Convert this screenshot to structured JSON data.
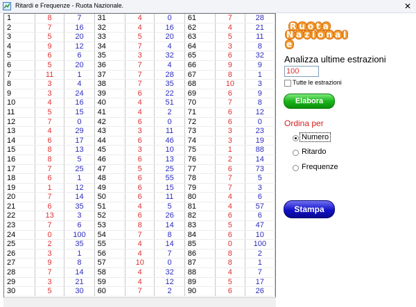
{
  "window": {
    "title": "Ritardi e Frequenze - Ruota Nazionale.",
    "close_symbol": "✕"
  },
  "logo": {
    "line1": "Ruota",
    "line2": "Nazionale",
    "color": "#f29a2e"
  },
  "controls": {
    "analizza_label": "Analizza ultime estrazioni",
    "estrazioni_value": "100",
    "tutte_label": "Tutte le estrazioni",
    "elabora_label": "Elabora",
    "ordina_label": "Ordina per",
    "sort_options": [
      "Numero",
      "Ritardo",
      "Frequenze"
    ],
    "sort_selected": "Numero",
    "stampa_label": "Stampa"
  },
  "colors": {
    "ritardo": "#e03030",
    "frequenza": "#2c2cc0",
    "elabora": "#1bb51b",
    "stampa": "#1212c8"
  },
  "table_rows": [
    [
      1,
      8,
      7,
      31,
      4,
      0,
      61,
      7,
      28
    ],
    [
      2,
      7,
      16,
      32,
      4,
      16,
      62,
      4,
      21
    ],
    [
      3,
      5,
      20,
      33,
      5,
      20,
      63,
      5,
      11
    ],
    [
      4,
      9,
      12,
      34,
      7,
      4,
      64,
      3,
      8
    ],
    [
      5,
      6,
      6,
      35,
      3,
      32,
      65,
      6,
      32
    ],
    [
      6,
      5,
      20,
      36,
      7,
      4,
      66,
      9,
      9
    ],
    [
      7,
      11,
      1,
      37,
      7,
      28,
      67,
      8,
      1
    ],
    [
      8,
      3,
      4,
      38,
      7,
      35,
      68,
      10,
      3
    ],
    [
      9,
      3,
      24,
      39,
      6,
      22,
      69,
      6,
      9
    ],
    [
      10,
      4,
      16,
      40,
      4,
      51,
      70,
      7,
      8
    ],
    [
      11,
      5,
      15,
      41,
      4,
      2,
      71,
      6,
      12
    ],
    [
      12,
      7,
      0,
      42,
      6,
      0,
      72,
      6,
      0
    ],
    [
      13,
      4,
      29,
      43,
      3,
      11,
      73,
      3,
      23
    ],
    [
      14,
      6,
      17,
      44,
      6,
      46,
      74,
      3,
      19
    ],
    [
      15,
      8,
      13,
      45,
      3,
      10,
      75,
      1,
      88
    ],
    [
      16,
      8,
      5,
      46,
      6,
      13,
      76,
      2,
      14
    ],
    [
      17,
      7,
      25,
      47,
      5,
      25,
      77,
      6,
      73
    ],
    [
      18,
      6,
      1,
      48,
      6,
      55,
      78,
      7,
      5
    ],
    [
      19,
      1,
      12,
      49,
      6,
      15,
      79,
      7,
      3
    ],
    [
      20,
      7,
      14,
      50,
      6,
      11,
      80,
      4,
      6
    ],
    [
      21,
      6,
      35,
      51,
      4,
      5,
      81,
      4,
      57
    ],
    [
      22,
      13,
      3,
      52,
      6,
      26,
      82,
      6,
      6
    ],
    [
      23,
      7,
      6,
      53,
      8,
      14,
      83,
      5,
      47
    ],
    [
      24,
      0,
      100,
      54,
      7,
      8,
      84,
      6,
      10
    ],
    [
      25,
      2,
      35,
      55,
      4,
      14,
      85,
      0,
      100
    ],
    [
      26,
      3,
      1,
      56,
      4,
      7,
      86,
      8,
      2
    ],
    [
      27,
      9,
      8,
      57,
      10,
      0,
      87,
      8,
      1
    ],
    [
      28,
      7,
      14,
      58,
      4,
      32,
      88,
      4,
      7
    ],
    [
      29,
      3,
      21,
      59,
      4,
      12,
      89,
      5,
      17
    ],
    [
      30,
      5,
      30,
      60,
      7,
      2,
      90,
      6,
      26
    ]
  ]
}
